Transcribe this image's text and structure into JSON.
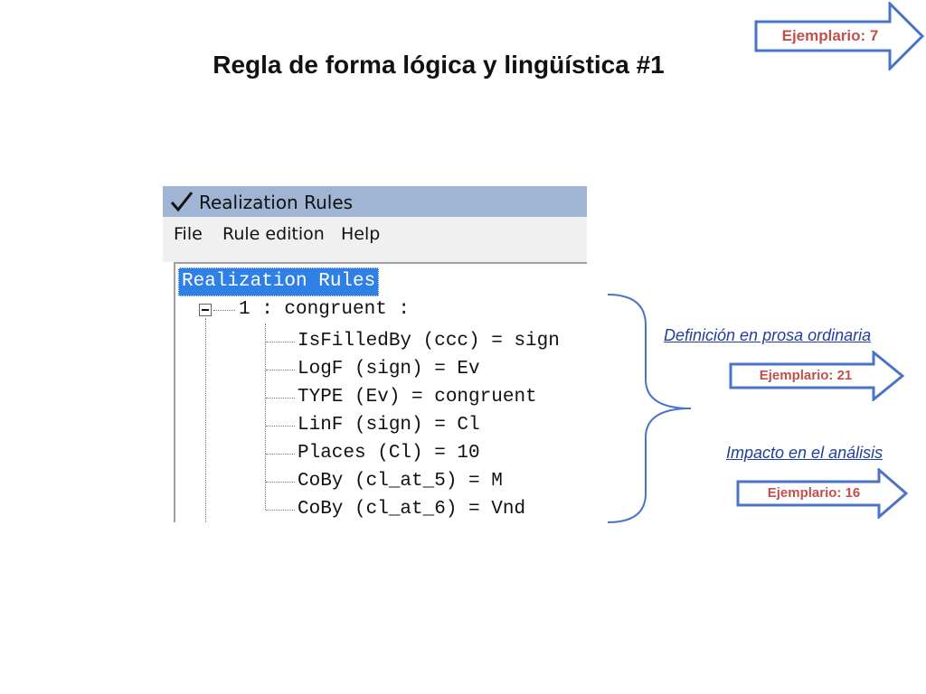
{
  "slide": {
    "title": "Regla de forma lógica y lingüística #1",
    "top_arrow": "Ejemplario: 7",
    "prose_link": "Definición en prosa ordinaria",
    "prose_arrow": "Ejemplario: 21",
    "impact_link": "Impacto en el análisis",
    "impact_arrow": "Ejemplario: 16"
  },
  "window": {
    "title": "Realization Rules",
    "menu": [
      "File",
      "Rule edition",
      "Help"
    ]
  },
  "tree": {
    "root": "Realization Rules",
    "rule": "1 : congruent :",
    "children": [
      "IsFilledBy (ccc) = sign",
      "LogF (sign) = Ev",
      "TYPE (Ev) = congruent",
      "LinF (sign) = Cl",
      "Places (Cl) = 10",
      "CoBy (cl_at_5) = M",
      "CoBy (cl_at_6) = Vnd"
    ]
  },
  "colors": {
    "arrow_text": "#c0504d",
    "arrow_stroke": "#4a74c9",
    "link": "#1f3f9c",
    "titlebar": "#9fb5d3",
    "selection": "#2e80e6"
  }
}
